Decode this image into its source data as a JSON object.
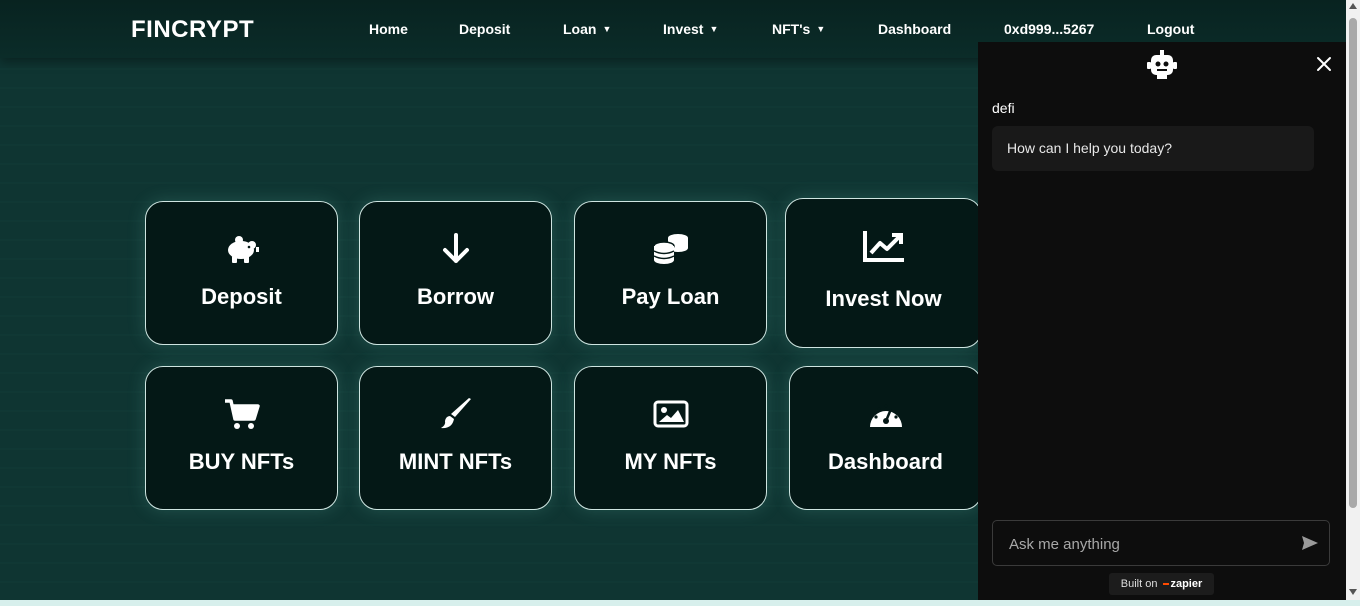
{
  "brand": "FINCRYPT",
  "nav": {
    "home": "Home",
    "deposit": "Deposit",
    "loan": "Loan",
    "invest": "Invest",
    "nfts": "NFT's",
    "dashboard": "Dashboard",
    "wallet": "0xd999...5267",
    "logout": "Logout"
  },
  "cards": [
    {
      "label": "Deposit",
      "icon": "piggy-bank-icon"
    },
    {
      "label": "Borrow",
      "icon": "arrow-down-icon"
    },
    {
      "label": "Pay Loan",
      "icon": "coins-icon"
    },
    {
      "label": "Invest Now",
      "icon": "chart-line-icon"
    },
    {
      "label": "BUY NFTs",
      "icon": "cart-icon"
    },
    {
      "label": "MINT NFTs",
      "icon": "paintbrush-icon"
    },
    {
      "label": "MY NFTs",
      "icon": "image-icon"
    },
    {
      "label": "Dashboard",
      "icon": "gauge-icon"
    }
  ],
  "chat": {
    "bot_name": "defi",
    "greeting": "How can I help you today?",
    "input_placeholder": "Ask me anything",
    "built_on": "Built on",
    "built_on_brand": "zapier"
  },
  "colors": {
    "background": "#0f3532",
    "card_bg": "#041816",
    "card_border": "#cfe5e1",
    "chat_bg": "#0d0d0d",
    "zapier_accent": "#ff4a00"
  }
}
